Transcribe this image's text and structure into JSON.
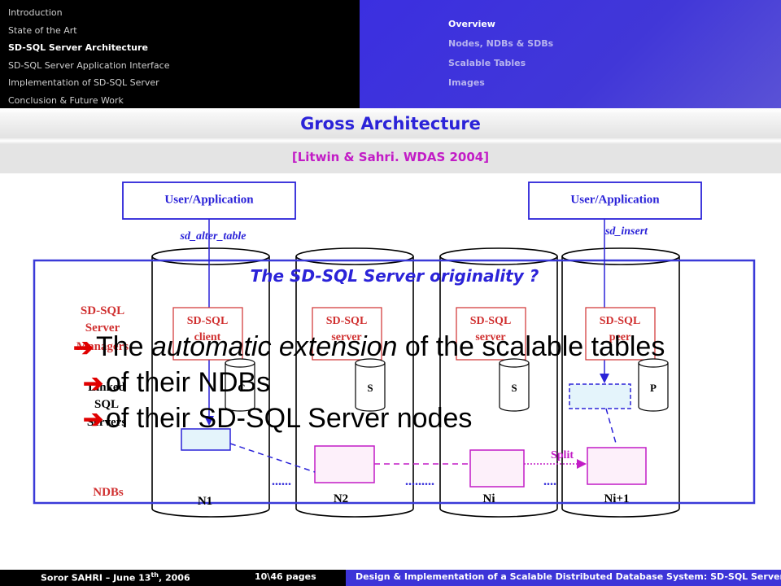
{
  "nav": {
    "sections": [
      "Introduction",
      "State of the Art",
      "SD-SQL Server Architecture",
      "SD-SQL Server Application Interface",
      "Implementation of SD-SQL Server",
      "Conclusion & Future Work"
    ],
    "active_section": 2,
    "subsections": [
      "Overview",
      "Nodes, NDBs & SDBs",
      "Scalable Tables",
      "Images"
    ],
    "active_subsection": 0
  },
  "slide": {
    "title": "Gross Architecture",
    "subtitle": "[Litwin & Sahri. WDAS 2004]"
  },
  "diagram": {
    "user_app_left": "User/Application",
    "user_app_right": "User/Application",
    "cmd_left": "sd_alter_table",
    "cmd_right": "sd_insert",
    "labels_left": {
      "managers_1": "SD-SQL",
      "managers_2": "Server",
      "managers_3": "Managers",
      "linked_1": "Linked",
      "linked_2": "SQL",
      "linked_3": "Servers",
      "ndbs": "NDBs"
    },
    "nodes": [
      {
        "label": "N1",
        "box1": "SD-SQL",
        "box2": "client",
        "small": "C"
      },
      {
        "label": "N2",
        "box1": "SD-SQL",
        "box2": "server",
        "small": "S"
      },
      {
        "label": "Ni",
        "box1": "SD-SQL",
        "box2": "server",
        "small": "S"
      },
      {
        "label": "Ni+1",
        "box1": "SD-SQL",
        "box2": "peer",
        "small": "P"
      }
    ],
    "dots_1": "......",
    "dots_2": ".........",
    "dots_3": "....",
    "split": "Split"
  },
  "overlay": {
    "title": "The SD-SQL Server originality ?",
    "bullet_1_pre": "The ",
    "bullet_1_em": "automatic extension",
    "bullet_1_post": " of the scalable tables",
    "bullet_2": "of their NDBs",
    "bullet_3": "of their SD-SQL Server nodes"
  },
  "footer": {
    "author": "Soror SAHRI – June 13",
    "author_sup": "th",
    "year": ", 2006",
    "pages": "10\\46 pages",
    "talk": "Design & Implementation of a Scalable Distributed Database System: SD-SQL Server"
  },
  "colors": {
    "blue": "#2b23d8",
    "magenta": "#c21cc6",
    "red": "#d03030",
    "pink_fill": "#fdf0fa",
    "cyan_fill": "#e4f4fb"
  }
}
